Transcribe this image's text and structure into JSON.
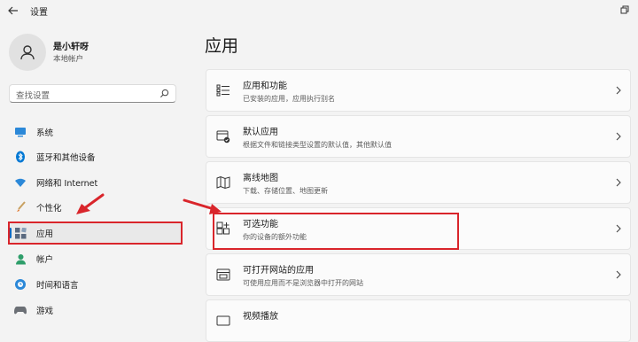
{
  "window": {
    "title": "设置"
  },
  "user": {
    "name": "是小轩呀",
    "account_type": "本地帐户"
  },
  "search": {
    "placeholder": "查找设置"
  },
  "sidebar": {
    "items": [
      {
        "label": "系统",
        "icon": "monitor-icon"
      },
      {
        "label": "蓝牙和其他设备",
        "icon": "bluetooth-icon"
      },
      {
        "label": "网络和 Internet",
        "icon": "wifi-icon"
      },
      {
        "label": "个性化",
        "icon": "brush-icon"
      },
      {
        "label": "应用",
        "icon": "apps-icon",
        "selected": true
      },
      {
        "label": "帐户",
        "icon": "person-icon"
      },
      {
        "label": "时间和语言",
        "icon": "globe-clock-icon"
      },
      {
        "label": "游戏",
        "icon": "gamepad-icon"
      }
    ]
  },
  "main": {
    "title": "应用",
    "cards": [
      {
        "title": "应用和功能",
        "subtitle": "已安装的应用，应用执行别名",
        "icon": "apps-list-icon"
      },
      {
        "title": "默认应用",
        "subtitle": "根据文件和链接类型设置的默认值，其他默认值",
        "icon": "default-apps-icon"
      },
      {
        "title": "离线地图",
        "subtitle": "下载、存储位置、地图更新",
        "icon": "map-icon"
      },
      {
        "title": "可选功能",
        "subtitle": "你的设备的额外功能",
        "icon": "optional-features-icon"
      },
      {
        "title": "可打开网站的应用",
        "subtitle": "可使用应用而不是浏览器中打开的网站",
        "icon": "web-apps-icon"
      },
      {
        "title": "视频播放",
        "subtitle": "",
        "icon": "video-icon"
      }
    ]
  },
  "colors": {
    "accent": "#0067c0",
    "highlight": "#d9252b"
  }
}
